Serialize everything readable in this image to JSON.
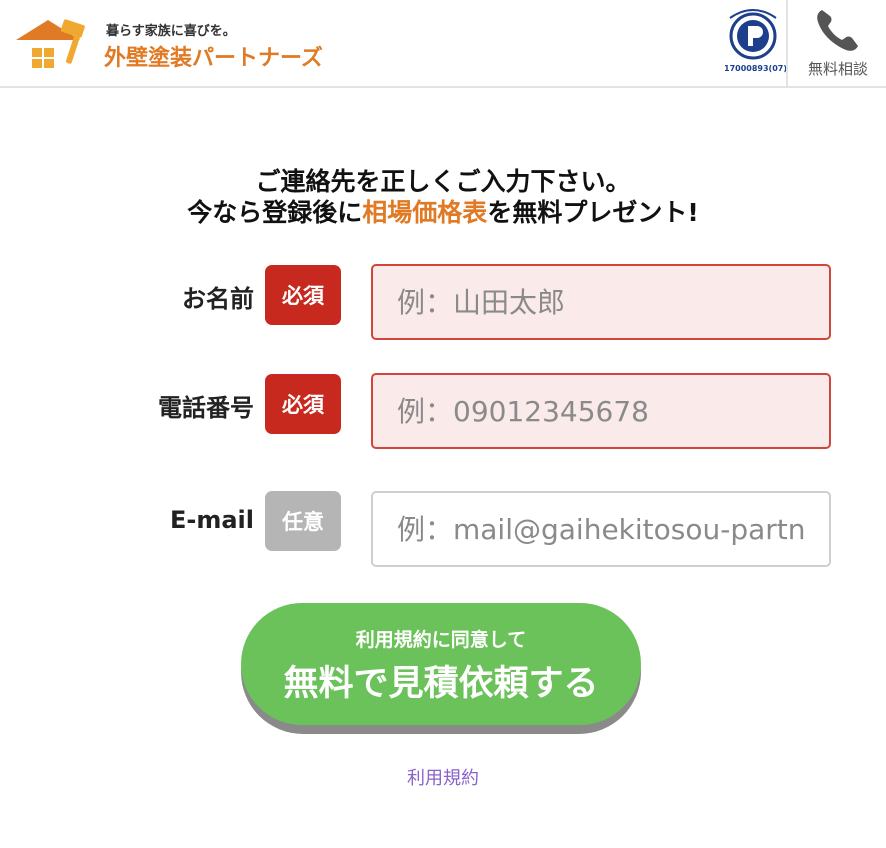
{
  "header": {
    "logo": {
      "tagline": "暮らす家族に喜びを。",
      "name": "外壁塗装パートナーズ",
      "icon": "house-paintbrush-icon"
    },
    "privacy_mark": {
      "icon": "privacy-mark-icon",
      "registration_no": "17000893(07)"
    },
    "phone": {
      "icon": "phone-icon",
      "label": "無料相談"
    }
  },
  "heading": {
    "line1": "ご連絡先を正しくご入力下さい。",
    "line2_before": "今なら登録後に",
    "line2_accent": "相場価格表",
    "line2_after": "を無料プレゼント!"
  },
  "form": {
    "name": {
      "label": "お名前",
      "badge": "必須",
      "placeholder": "例：山田太郎"
    },
    "phone": {
      "label": "電話番号",
      "badge": "必須",
      "placeholder": "例：09012345678"
    },
    "email": {
      "label": "E-mail",
      "badge": "任意",
      "placeholder": "例：mail@gaihekitosou-partners.jp"
    }
  },
  "submit": {
    "sub_label": "利用規約に同意して",
    "main_label": "無料で見積依頼する"
  },
  "terms_link": "利用規約",
  "colors": {
    "brand_orange": "#e07a24",
    "required_red": "#c8291e",
    "optional_gray": "#b5b5b5",
    "submit_green": "#6cc25a",
    "link_purple": "#8a63c9",
    "privacy_blue": "#1d3f8c"
  }
}
